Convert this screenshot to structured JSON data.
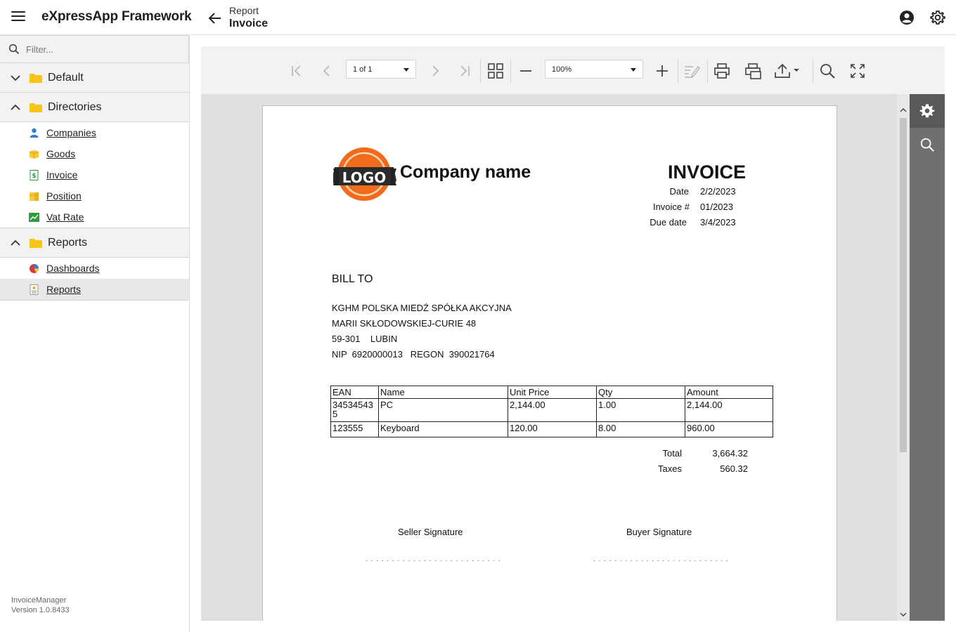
{
  "header": {
    "app_title": "eXpressApp Framework",
    "breadcrumb_parent": "Report",
    "breadcrumb_current": "Invoice"
  },
  "sidebar": {
    "filter_placeholder": "Filter...",
    "groups": [
      {
        "label": "Default",
        "expanded": false,
        "items": []
      },
      {
        "label": "Directories",
        "expanded": true,
        "items": [
          {
            "label": "Companies",
            "icon": "user-icon"
          },
          {
            "label": "Goods",
            "icon": "box-icon"
          },
          {
            "label": "Invoice",
            "icon": "invoice-icon"
          },
          {
            "label": "Position",
            "icon": "boxes-icon"
          },
          {
            "label": "Vat Rate",
            "icon": "chart-up-icon"
          }
        ]
      },
      {
        "label": "Reports",
        "expanded": true,
        "items": [
          {
            "label": "Dashboards",
            "icon": "pie-chart-icon"
          },
          {
            "label": "Reports",
            "icon": "report-icon",
            "selected": true
          }
        ]
      }
    ],
    "footer_app": "InvoiceManager",
    "footer_version": "Version 1.0.8433"
  },
  "toolbar": {
    "page_select": "1 of 1",
    "zoom_select": "100%"
  },
  "invoice": {
    "logo_text": "LOGO",
    "company_name": "Company name",
    "title": "INVOICE",
    "date_label": "Date",
    "date_value": "2/2/2023",
    "invoice_no_label": "Invoice #",
    "invoice_no_value": "01/2023",
    "due_label": "Due date",
    "due_value": "3/4/2023",
    "bill_to_label": "BILL TO",
    "bill_to_lines": [
      "KGHM POLSKA MIEDŹ SPÓŁKA AKCYJNA",
      "MARII SKŁODOWSKIEJ-CURIE 48",
      "59-301    LUBIN",
      "NIP  6920000013   REGON  390021764"
    ],
    "table_headers": [
      "EAN",
      "Name",
      "Unit Price",
      "Qty",
      "Amount"
    ],
    "rows": [
      {
        "ean_line1": "34534543",
        "ean_line2": "5",
        "name": "PC",
        "unit_price": "2,144.00",
        "qty": "1.00",
        "amount": "2,144.00"
      },
      {
        "ean_line1": "123555",
        "ean_line2": "",
        "name": "Keyboard",
        "unit_price": "120.00",
        "qty": "8.00",
        "amount": "960.00"
      }
    ],
    "total_label": "Total",
    "total_value": "3,664.32",
    "taxes_label": "Taxes",
    "taxes_value": "560.32",
    "seller_signature": "Seller Signature",
    "buyer_signature": "Buyer Signature",
    "signature_dots": ". . . . . . . . . . . . . . . . . . . . . . . . . ."
  },
  "colors": {
    "logo_orange": "#f26b1d",
    "logo_ribbon": "#2b2b2b",
    "folder_yellow": "#f5c518",
    "side_panel": "#707070"
  }
}
